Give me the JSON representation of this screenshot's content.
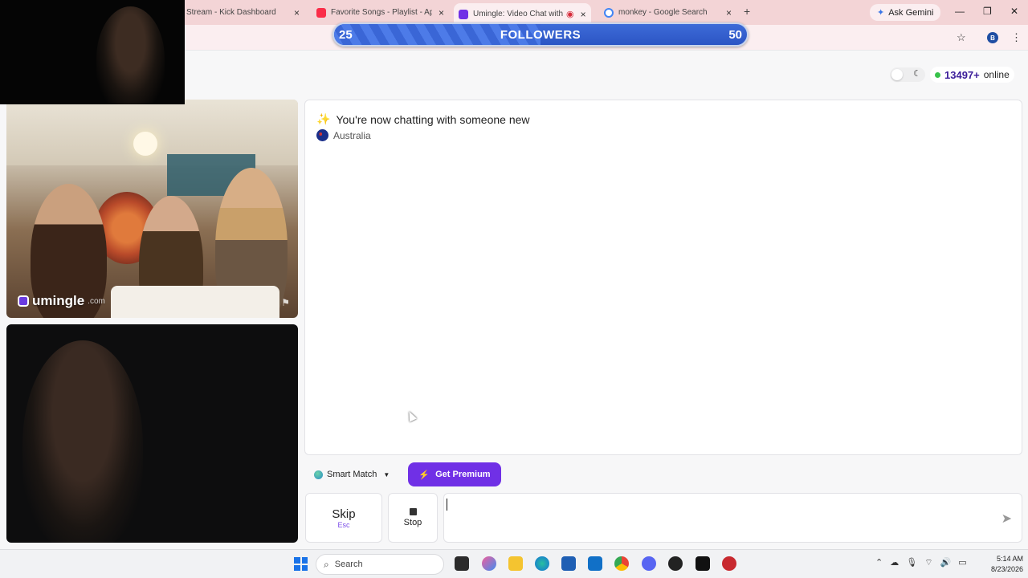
{
  "browser": {
    "tabs": [
      {
        "label": "Stream - Kick Dashboard",
        "active": false,
        "color": "#53fc18"
      },
      {
        "label": "Favorite Songs - Playlist - Apple",
        "active": false,
        "color": "#fa2d48"
      },
      {
        "label": "Umingle: Video Chat with St",
        "active": true,
        "color": "#7030e6"
      },
      {
        "label": "monkey - Google Search",
        "active": false,
        "color": "#4285f4"
      }
    ],
    "ask_gemini": "Ask Gemini",
    "profile_initial": "B"
  },
  "followers_goal": {
    "current": "25",
    "label": "FOLLOWERS",
    "target": "50",
    "progress": 0.5
  },
  "header": {
    "online_count": "13497+",
    "online_label": "online"
  },
  "video": {
    "logo_text": "umingle",
    "logo_suffix": ".com"
  },
  "chat": {
    "message": "You're now chatting with someone new",
    "country": "Australia"
  },
  "controls": {
    "smart_match": "Smart Match",
    "get_premium": "Get Premium",
    "skip_label": "Skip",
    "skip_key": "Esc",
    "stop_label": "Stop"
  },
  "taskbar": {
    "search_placeholder": "Search",
    "time": "5:14 AM",
    "date": "8/23/2026"
  }
}
